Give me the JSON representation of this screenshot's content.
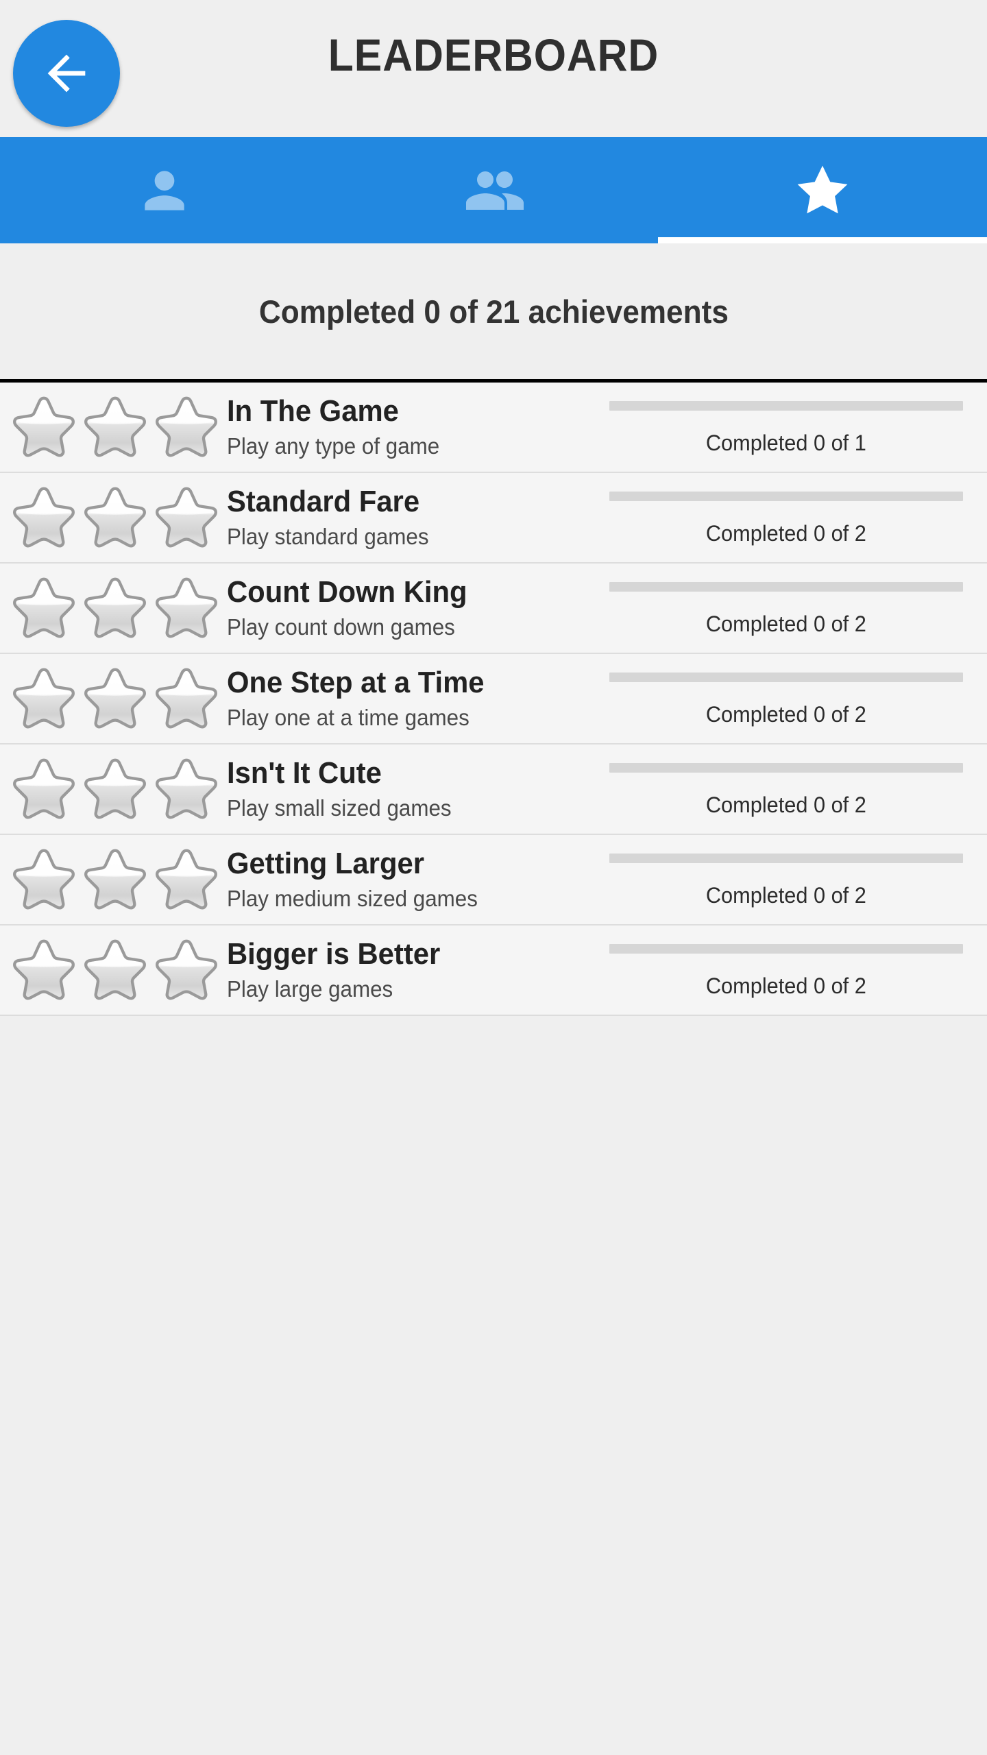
{
  "header": {
    "title": "LEADERBOARD",
    "back_icon": "arrow-left-icon",
    "background_color": "#efefef",
    "accent_color": "#2288e0"
  },
  "tabs": {
    "selected_index": 2,
    "background_color": "#2288e0",
    "inactive_icon_color": "#90c4f0",
    "active_icon_color": "#ffffff",
    "items": [
      {
        "icon": "person-icon",
        "label": "Me",
        "selected": false
      },
      {
        "icon": "group-icon",
        "label": "Friends",
        "selected": false
      },
      {
        "icon": "star-icon",
        "label": "Achievements",
        "selected": true
      }
    ]
  },
  "summary": {
    "text": "Completed 0 of 21 achievements",
    "completed": 0,
    "total": 21
  },
  "achievements": [
    {
      "title": "In The Game",
      "description": "Play any type of game",
      "progress_text": "Completed 0 of 1",
      "completed": 0,
      "total": 1,
      "percent": 0,
      "stars": 3,
      "stars_earned": 0
    },
    {
      "title": "Standard Fare",
      "description": "Play standard games",
      "progress_text": "Completed 0 of 2",
      "completed": 0,
      "total": 2,
      "percent": 0,
      "stars": 3,
      "stars_earned": 0
    },
    {
      "title": "Count Down King",
      "description": "Play count down games",
      "progress_text": "Completed 0 of 2",
      "completed": 0,
      "total": 2,
      "percent": 0,
      "stars": 3,
      "stars_earned": 0
    },
    {
      "title": "One Step at a Time",
      "description": "Play one at a time games",
      "progress_text": "Completed 0 of 2",
      "completed": 0,
      "total": 2,
      "percent": 0,
      "stars": 3,
      "stars_earned": 0
    },
    {
      "title": "Isn't It Cute",
      "description": "Play small sized games",
      "progress_text": "Completed 0 of 2",
      "completed": 0,
      "total": 2,
      "percent": 0,
      "stars": 3,
      "stars_earned": 0
    },
    {
      "title": "Getting Larger",
      "description": "Play medium sized games",
      "progress_text": "Completed 0 of 2",
      "completed": 0,
      "total": 2,
      "percent": 0,
      "stars": 3,
      "stars_earned": 0
    },
    {
      "title": "Bigger is Better",
      "description": "Play large games",
      "progress_text": "Completed 0 of 2",
      "completed": 0,
      "total": 2,
      "percent": 0,
      "stars": 3,
      "stars_earned": 0
    }
  ]
}
